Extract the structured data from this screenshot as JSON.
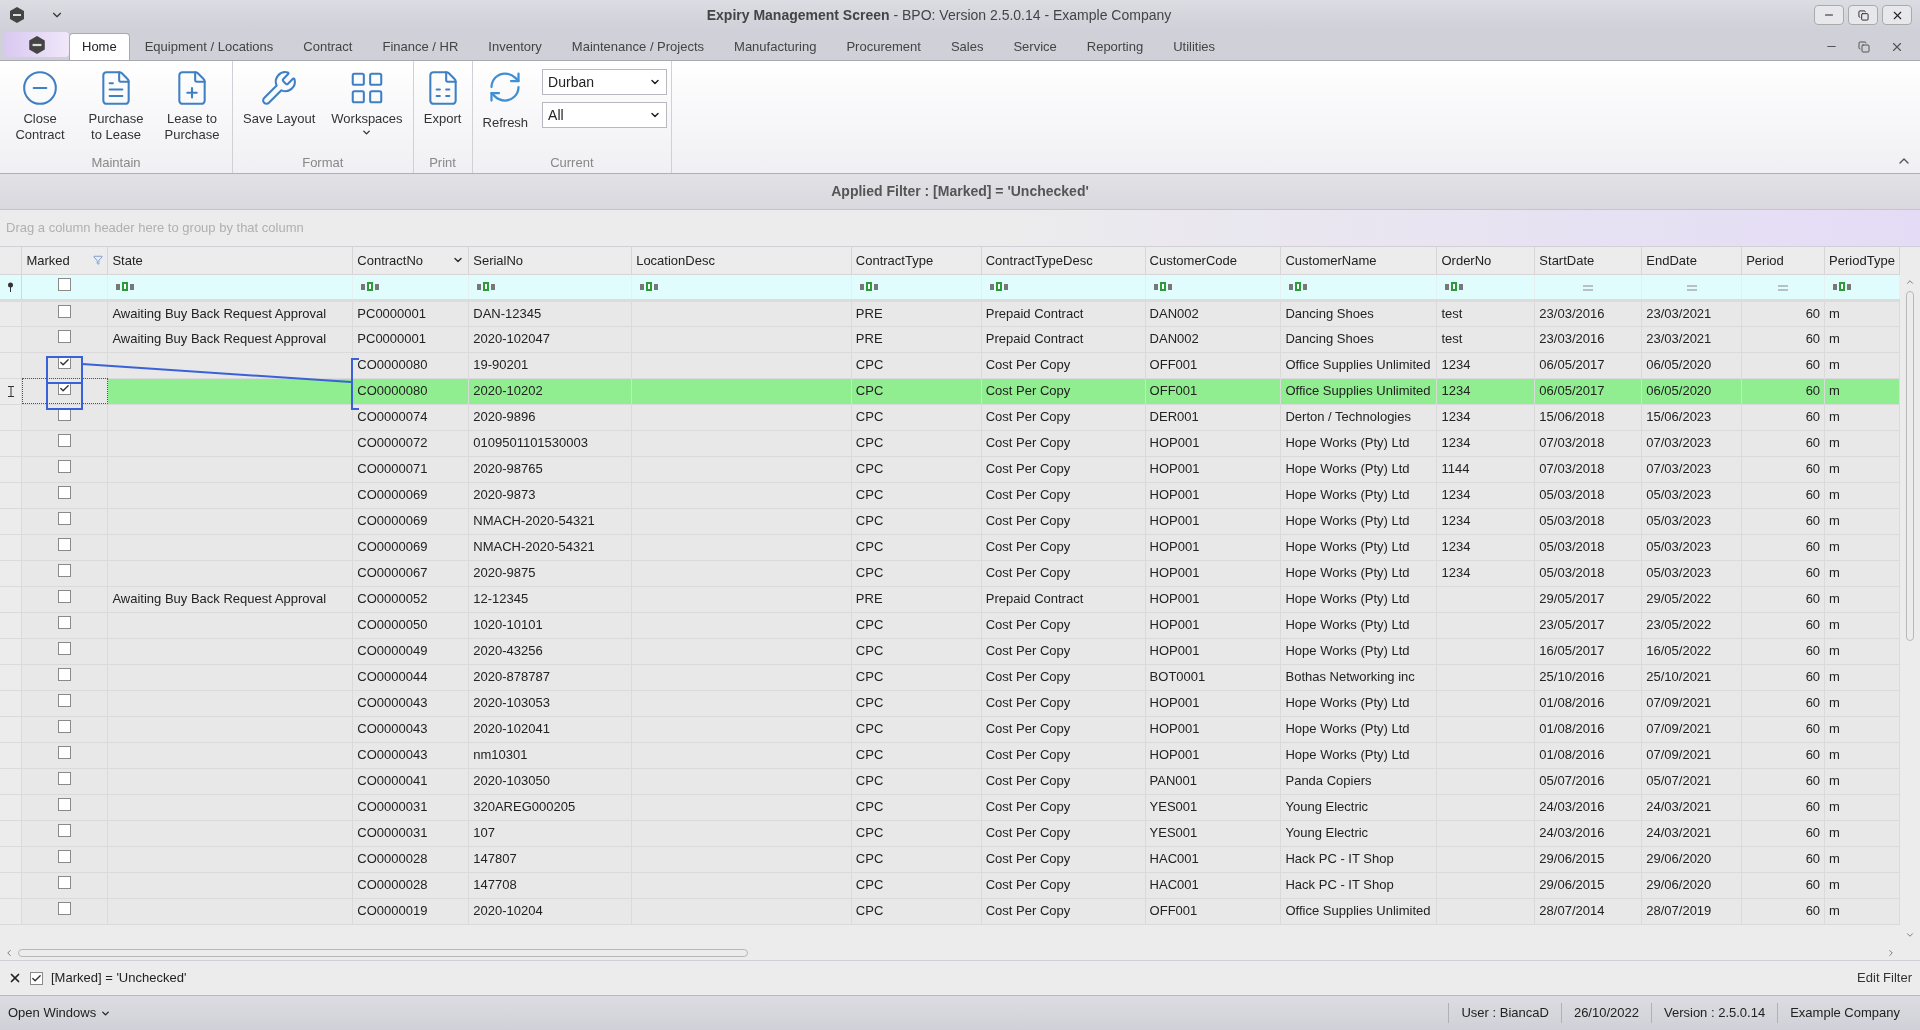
{
  "window": {
    "title_bold": "Expiry Management Screen",
    "title_rest": " - BPO: Version 2.5.0.14 - Example Company"
  },
  "tabs": [
    {
      "label": "Home",
      "selected": true
    },
    {
      "label": "Equipment / Locations",
      "selected": false
    },
    {
      "label": "Contract",
      "selected": false
    },
    {
      "label": "Finance / HR",
      "selected": false
    },
    {
      "label": "Inventory",
      "selected": false
    },
    {
      "label": "Maintenance / Projects",
      "selected": false
    },
    {
      "label": "Manufacturing",
      "selected": false
    },
    {
      "label": "Procurement",
      "selected": false
    },
    {
      "label": "Sales",
      "selected": false
    },
    {
      "label": "Service",
      "selected": false
    },
    {
      "label": "Reporting",
      "selected": false
    },
    {
      "label": "Utilities",
      "selected": false
    }
  ],
  "ribbon": {
    "groups": [
      {
        "label": "Maintain",
        "buttons": [
          {
            "label": "Close Contract",
            "dropdown": false
          },
          {
            "label": "Purchase to Lease",
            "dropdown": false
          },
          {
            "label": "Lease to Purchase",
            "dropdown": false
          }
        ]
      },
      {
        "label": "Format",
        "buttons": [
          {
            "label": "Save Layout",
            "dropdown": false
          },
          {
            "label": "Workspaces",
            "dropdown": true
          }
        ]
      },
      {
        "label": "Print",
        "buttons": [
          {
            "label": "Export",
            "dropdown": false
          }
        ]
      }
    ],
    "current": {
      "label": "Current",
      "button": "Refresh",
      "dropdowns": [
        "Durban",
        "All"
      ]
    }
  },
  "applied_filter": "Applied Filter : [Marked] = 'Unchecked'",
  "marked_filter": {
    "checked": false
  },
  "group_panel_hint": "Drag a column header here to group by that column",
  "columns": [
    {
      "label": "Marked",
      "kind": "check",
      "filtered": true,
      "sorted": false
    },
    {
      "label": "State",
      "kind": "text",
      "filtered": false,
      "sorted": false
    },
    {
      "label": "ContractNo",
      "kind": "text",
      "filtered": false,
      "sorted": true
    },
    {
      "label": "SerialNo",
      "kind": "text",
      "filtered": false,
      "sorted": false
    },
    {
      "label": "LocationDesc",
      "kind": "text",
      "filtered": false,
      "sorted": false
    },
    {
      "label": "ContractType",
      "kind": "text",
      "filtered": false,
      "sorted": false
    },
    {
      "label": "ContractTypeDesc",
      "kind": "text",
      "filtered": false,
      "sorted": false
    },
    {
      "label": "CustomerCode",
      "kind": "text",
      "filtered": false,
      "sorted": false
    },
    {
      "label": "CustomerName",
      "kind": "text",
      "filtered": false,
      "sorted": false
    },
    {
      "label": "OrderNo",
      "kind": "text",
      "filtered": false,
      "sorted": false
    },
    {
      "label": "StartDate",
      "kind": "equals",
      "filtered": false,
      "sorted": false
    },
    {
      "label": "EndDate",
      "kind": "equals",
      "filtered": false,
      "sorted": false
    },
    {
      "label": "Period",
      "kind": "equals",
      "filtered": false,
      "sorted": false
    },
    {
      "label": "PeriodType",
      "kind": "text",
      "filtered": false,
      "sorted": false
    }
  ],
  "rows": [
    {
      "marked": false,
      "selected": false,
      "cells": [
        "Awaiting Buy Back Request Approval",
        "PC0000001",
        "DAN-12345",
        "",
        "PRE",
        "Prepaid Contract",
        "DAN002",
        "Dancing Shoes",
        "test",
        "23/03/2016",
        "23/03/2021",
        "60",
        "m"
      ]
    },
    {
      "marked": false,
      "selected": false,
      "cells": [
        "Awaiting Buy Back Request Approval",
        "PC0000001",
        "2020-102047",
        "",
        "PRE",
        "Prepaid Contract",
        "DAN002",
        "Dancing Shoes",
        "test",
        "23/03/2016",
        "23/03/2021",
        "60",
        "m"
      ]
    },
    {
      "marked": true,
      "selected": false,
      "cells": [
        "",
        "CO0000080",
        "19-90201",
        "",
        "CPC",
        "Cost Per Copy",
        "OFF001",
        "Office Supplies Unlimited",
        "1234",
        "06/05/2017",
        "06/05/2020",
        "60",
        "m"
      ]
    },
    {
      "marked": true,
      "selected": true,
      "cells": [
        "",
        "CO0000080",
        "2020-10202",
        "",
        "CPC",
        "Cost Per Copy",
        "OFF001",
        "Office Supplies Unlimited",
        "1234",
        "06/05/2017",
        "06/05/2020",
        "60",
        "m"
      ]
    },
    {
      "marked": false,
      "selected": false,
      "cells": [
        "",
        "CO0000074",
        "2020-9896",
        "",
        "CPC",
        "Cost Per Copy",
        "DER001",
        "Derton / Technologies",
        "1234",
        "15/06/2018",
        "15/06/2023",
        "60",
        "m"
      ]
    },
    {
      "marked": false,
      "selected": false,
      "cells": [
        "",
        "CO0000072",
        "0109501101530003",
        "",
        "CPC",
        "Cost Per Copy",
        "HOP001",
        "Hope Works (Pty) Ltd",
        "1234",
        "07/03/2018",
        "07/03/2023",
        "60",
        "m"
      ]
    },
    {
      "marked": false,
      "selected": false,
      "cells": [
        "",
        "CO0000071",
        "2020-98765",
        "",
        "CPC",
        "Cost Per Copy",
        "HOP001",
        "Hope Works (Pty) Ltd",
        "1144",
        "07/03/2018",
        "07/03/2023",
        "60",
        "m"
      ]
    },
    {
      "marked": false,
      "selected": false,
      "cells": [
        "",
        "CO0000069",
        "2020-9873",
        "",
        "CPC",
        "Cost Per Copy",
        "HOP001",
        "Hope Works (Pty) Ltd",
        "1234",
        "05/03/2018",
        "05/03/2023",
        "60",
        "m"
      ]
    },
    {
      "marked": false,
      "selected": false,
      "cells": [
        "",
        "CO0000069",
        "NMACH-2020-54321",
        "",
        "CPC",
        "Cost Per Copy",
        "HOP001",
        "Hope Works (Pty) Ltd",
        "1234",
        "05/03/2018",
        "05/03/2023",
        "60",
        "m"
      ]
    },
    {
      "marked": false,
      "selected": false,
      "cells": [
        "",
        "CO0000069",
        "NMACH-2020-54321",
        "",
        "CPC",
        "Cost Per Copy",
        "HOP001",
        "Hope Works (Pty) Ltd",
        "1234",
        "05/03/2018",
        "05/03/2023",
        "60",
        "m"
      ]
    },
    {
      "marked": false,
      "selected": false,
      "cells": [
        "",
        "CO0000067",
        "2020-9875",
        "",
        "CPC",
        "Cost Per Copy",
        "HOP001",
        "Hope Works (Pty) Ltd",
        "1234",
        "05/03/2018",
        "05/03/2023",
        "60",
        "m"
      ]
    },
    {
      "marked": false,
      "selected": false,
      "cells": [
        "Awaiting Buy Back Request Approval",
        "CO0000052",
        "12-12345",
        "",
        "PRE",
        "Prepaid Contract",
        "HOP001",
        "Hope Works (Pty) Ltd",
        "",
        "29/05/2017",
        "29/05/2022",
        "60",
        "m"
      ]
    },
    {
      "marked": false,
      "selected": false,
      "cells": [
        "",
        "CO0000050",
        "1020-10101",
        "",
        "CPC",
        "Cost Per Copy",
        "HOP001",
        "Hope Works (Pty) Ltd",
        "",
        "23/05/2017",
        "23/05/2022",
        "60",
        "m"
      ]
    },
    {
      "marked": false,
      "selected": false,
      "cells": [
        "",
        "CO0000049",
        "2020-43256",
        "",
        "CPC",
        "Cost Per Copy",
        "HOP001",
        "Hope Works (Pty) Ltd",
        "",
        "16/05/2017",
        "16/05/2022",
        "60",
        "m"
      ]
    },
    {
      "marked": false,
      "selected": false,
      "cells": [
        "",
        "CO0000044",
        "2020-878787",
        "",
        "CPC",
        "Cost Per Copy",
        "BOT0001",
        "Bothas Networking inc",
        "",
        "25/10/2016",
        "25/10/2021",
        "60",
        "m"
      ]
    },
    {
      "marked": false,
      "selected": false,
      "cells": [
        "",
        "CO0000043",
        "2020-103053",
        "",
        "CPC",
        "Cost Per Copy",
        "HOP001",
        "Hope Works (Pty) Ltd",
        "",
        "01/08/2016",
        "07/09/2021",
        "60",
        "m"
      ]
    },
    {
      "marked": false,
      "selected": false,
      "cells": [
        "",
        "CO0000043",
        "2020-102041",
        "",
        "CPC",
        "Cost Per Copy",
        "HOP001",
        "Hope Works (Pty) Ltd",
        "",
        "01/08/2016",
        "07/09/2021",
        "60",
        "m"
      ]
    },
    {
      "marked": false,
      "selected": false,
      "cells": [
        "",
        "CO0000043",
        "nm10301",
        "",
        "CPC",
        "Cost Per Copy",
        "HOP001",
        "Hope Works (Pty) Ltd",
        "",
        "01/08/2016",
        "07/09/2021",
        "60",
        "m"
      ]
    },
    {
      "marked": false,
      "selected": false,
      "cells": [
        "",
        "CO0000041",
        "2020-103050",
        "",
        "CPC",
        "Cost Per Copy",
        "PAN001",
        "Panda Copiers",
        "",
        "05/07/2016",
        "05/07/2021",
        "60",
        "m"
      ]
    },
    {
      "marked": false,
      "selected": false,
      "cells": [
        "",
        "CO0000031",
        "320AREG000205",
        "",
        "CPC",
        "Cost Per Copy",
        "YES001",
        "Young Electric",
        "",
        "24/03/2016",
        "24/03/2021",
        "60",
        "m"
      ]
    },
    {
      "marked": false,
      "selected": false,
      "cells": [
        "",
        "CO0000031",
        "107",
        "",
        "CPC",
        "Cost Per Copy",
        "YES001",
        "Young Electric",
        "",
        "24/03/2016",
        "24/03/2021",
        "60",
        "m"
      ]
    },
    {
      "marked": false,
      "selected": false,
      "cells": [
        "",
        "CO0000028",
        "147807",
        "",
        "CPC",
        "Cost Per Copy",
        "HAC001",
        "Hack PC - IT Shop",
        "",
        "29/06/2015",
        "29/06/2020",
        "60",
        "m"
      ]
    },
    {
      "marked": false,
      "selected": false,
      "cells": [
        "",
        "CO0000028",
        "147708",
        "",
        "CPC",
        "Cost Per Copy",
        "HAC001",
        "Hack PC - IT Shop",
        "",
        "29/06/2015",
        "29/06/2020",
        "60",
        "m"
      ]
    },
    {
      "marked": false,
      "selected": false,
      "cells": [
        "",
        "CO0000019",
        "2020-10204",
        "",
        "CPC",
        "Cost Per Copy",
        "OFF001",
        "Office Supplies Unlimited",
        "",
        "28/07/2014",
        "28/07/2019",
        "60",
        "m"
      ]
    }
  ],
  "filter_panel": {
    "enabled": true,
    "text": "[Marked] = 'Unchecked'",
    "edit": "Edit Filter"
  },
  "status_bar": {
    "open_windows": "Open Windows",
    "items": [
      "User : BiancaD",
      "26/10/2022",
      "Version : 2.5.0.14",
      "Example Company"
    ]
  }
}
